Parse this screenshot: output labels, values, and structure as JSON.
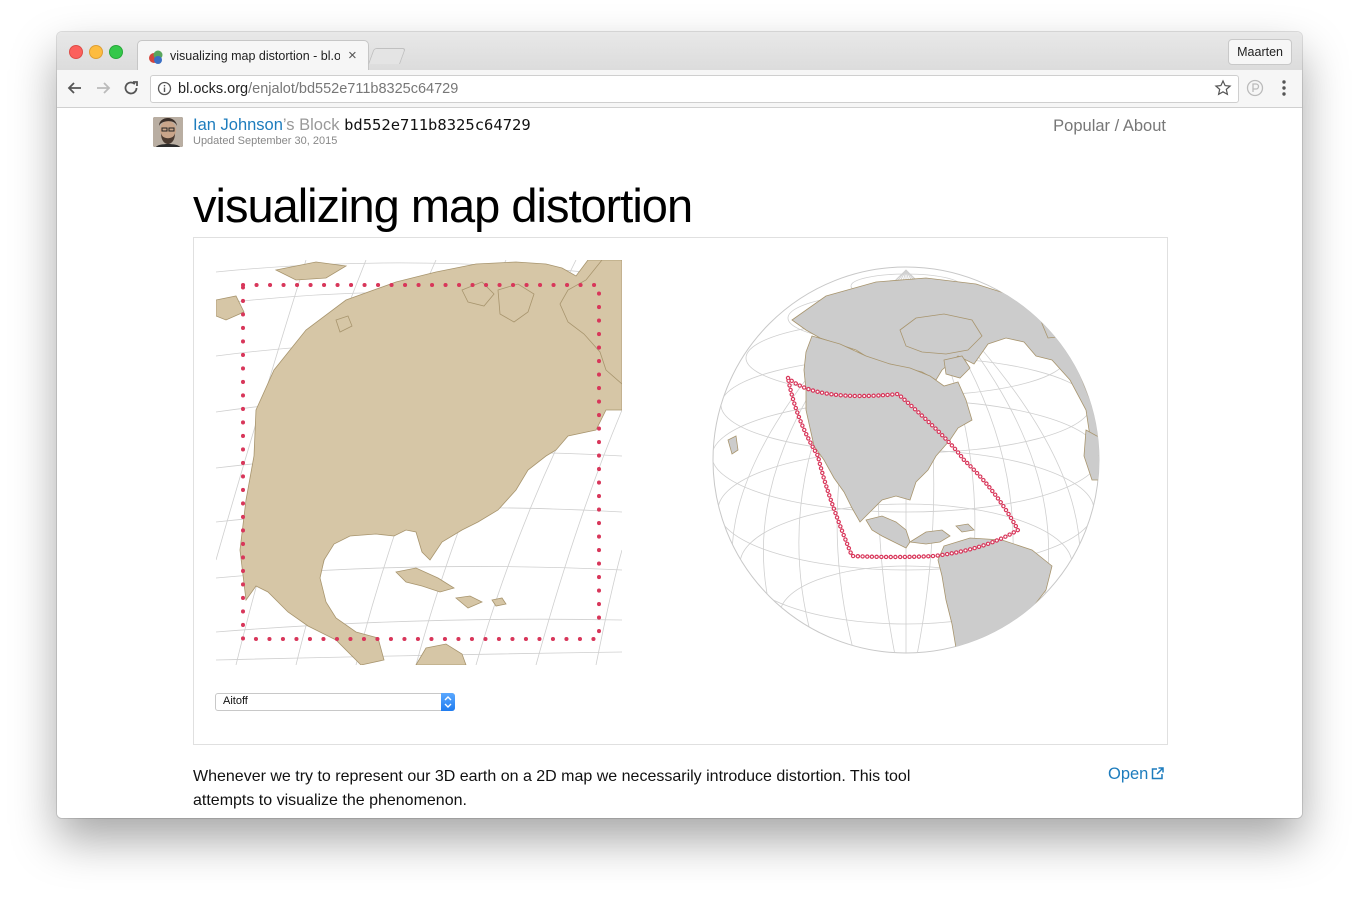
{
  "browser": {
    "tab_title": "visualizing map distortion - bl.ocks.org",
    "tab_close": "×",
    "profile_name": "Maarten",
    "url_host": "bl.ocks.org",
    "url_path": "/enjalot/bd552e711b8325c64729"
  },
  "header": {
    "author": "Ian Johnson",
    "block_label": "’s Block",
    "block_id": "bd552e711b8325c64729",
    "updated": "Updated September 30, 2015",
    "nav": "Popular / About"
  },
  "page": {
    "title": "visualizing map distortion",
    "projection_select": "Aitoff",
    "description": "Whenever we try to represent our 3D earth on a 2D map we necessarily introduce distortion. This tool attempts to visualize the phenomenon.",
    "open_link": "Open"
  },
  "colors": {
    "land_flat": "#d6c6a6",
    "land_globe": "#cccccc",
    "coast": "#a8956e",
    "outline": "#d8365a",
    "link": "#1d7cbd"
  },
  "icons": [
    "back-arrow-icon",
    "forward-arrow-icon",
    "reload-icon",
    "info-icon",
    "star-icon",
    "extension-icon",
    "kebab-menu-icon",
    "external-link-icon",
    "select-arrows-icon"
  ]
}
